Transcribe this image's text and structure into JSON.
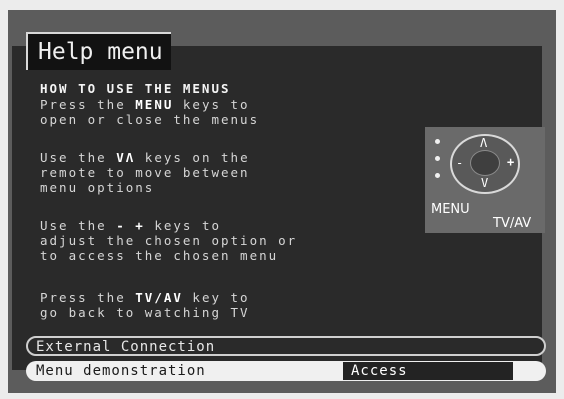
{
  "title": "Help menu",
  "instructions": {
    "heading": "HOW TO USE THE MENUS",
    "p1": {
      "line1_pre": "Press the ",
      "line1_key": "MENU",
      "line1_post": " keys to",
      "line2": "open or close the menus"
    },
    "p2": {
      "line1_pre": "Use the ",
      "line1_key": "VΛ",
      "line1_post": " keys on the",
      "line2": "remote to move between",
      "line3": "menu options"
    },
    "p3": {
      "line1_pre": "Use the ",
      "line1_key": "- +",
      "line1_post": " keys to",
      "line2": "adjust the chosen option or",
      "line3": "to access the chosen menu"
    },
    "p4": {
      "line1_pre": "Press the ",
      "line1_key": "TV/AV",
      "line1_post": " key to",
      "line2": "go back to watching TV"
    }
  },
  "remote_graphic": {
    "label_menu": "MENU",
    "label_tvav": "TV/AV",
    "arrows": {
      "up": "Λ",
      "down": "V",
      "left": "-",
      "right": "+"
    }
  },
  "menu_items": [
    {
      "label": "External Connection"
    },
    {
      "label": "Menu demonstration",
      "value": "Access"
    }
  ]
}
